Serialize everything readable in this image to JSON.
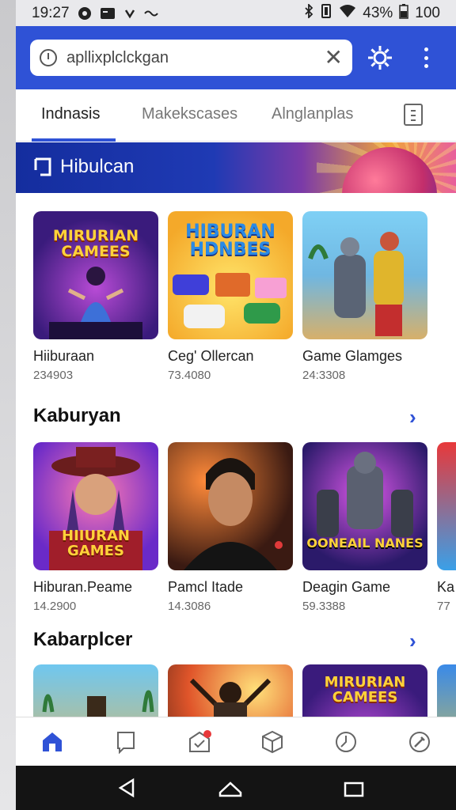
{
  "status": {
    "time": "19:27",
    "battery": "43%",
    "right_number": "100"
  },
  "search": {
    "value": "apllixplclckgan",
    "clear_label": "✕"
  },
  "tabs": [
    {
      "label": "Indnasis"
    },
    {
      "label": "Makekscases"
    },
    {
      "label": "Alnglanplas"
    }
  ],
  "banner": {
    "title": "Hibulcan"
  },
  "row1": [
    {
      "title": "Hiiburaan",
      "value": "234903",
      "art": "MIRURIAN CAMEES"
    },
    {
      "title": "Ceg' Ollercan",
      "value": "73.4080",
      "art": "HIBURAN HDNBES"
    },
    {
      "title": "Game Glamges",
      "value": "24:3308"
    }
  ],
  "section2": {
    "title": "Kaburyan",
    "arrow": "›"
  },
  "row2": [
    {
      "title": "Hiburan.Peame",
      "value": "14.2900",
      "art": "HIIURAN GAMES"
    },
    {
      "title": "Pamcl Itade",
      "value": "14.3086"
    },
    {
      "title": "Deagin Game",
      "value": "59.3388",
      "art": "OONEAIL NANES"
    },
    {
      "title": "Ka",
      "value": "77"
    }
  ],
  "section3": {
    "title": "Kabarplcer",
    "arrow": "›"
  },
  "row3": [
    {
      "title": "",
      "value": ""
    },
    {
      "title": "",
      "value": ""
    },
    {
      "title": "",
      "value": "",
      "art": "MIRURIAN CAMEES"
    }
  ],
  "colors": {
    "accent": "#2f52d6",
    "topbar": "#2f52d6"
  },
  "bottom_nav": [
    "home-icon",
    "book-icon",
    "notification-icon",
    "box-icon",
    "history-icon",
    "settings-icon"
  ]
}
